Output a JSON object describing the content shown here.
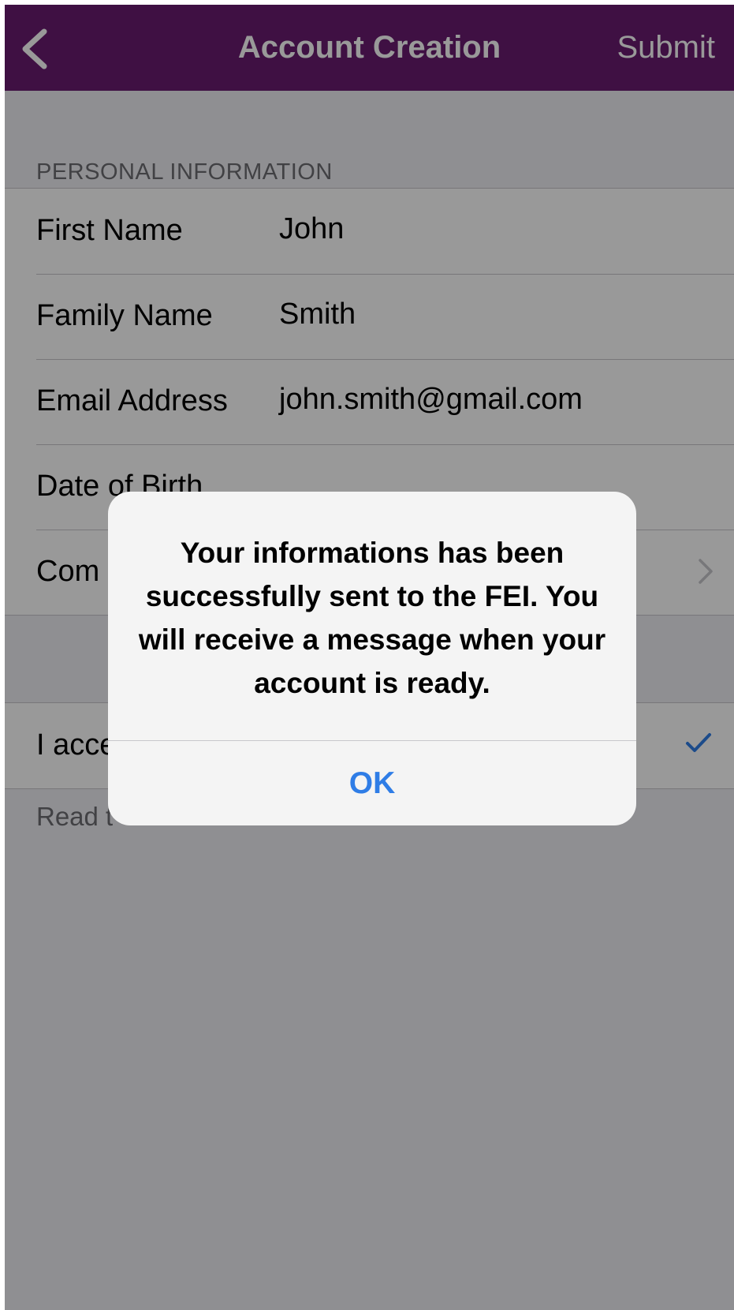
{
  "navbar": {
    "title": "Account Creation",
    "submit_label": "Submit",
    "back_icon": "chevron-left-icon",
    "background_color": "#6a1b71"
  },
  "personal_section": {
    "header": "PERSONAL INFORMATION",
    "rows": [
      {
        "label": "First Name",
        "value": "John"
      },
      {
        "label": "Family Name",
        "value": "Smith"
      },
      {
        "label": "Email Address",
        "value": "john.smith@gmail.com"
      },
      {
        "label": "Date of Birth",
        "value": ""
      },
      {
        "label": "Com",
        "value": ""
      }
    ]
  },
  "terms_section": {
    "accept_label": "I acce",
    "accept_checked": true,
    "footer_note": "Read t"
  },
  "alert": {
    "message": "Your informations has been successfully sent to the FEI. You will receive a message when your account is ready.",
    "ok_label": "OK",
    "ok_color": "#2f7de6"
  }
}
